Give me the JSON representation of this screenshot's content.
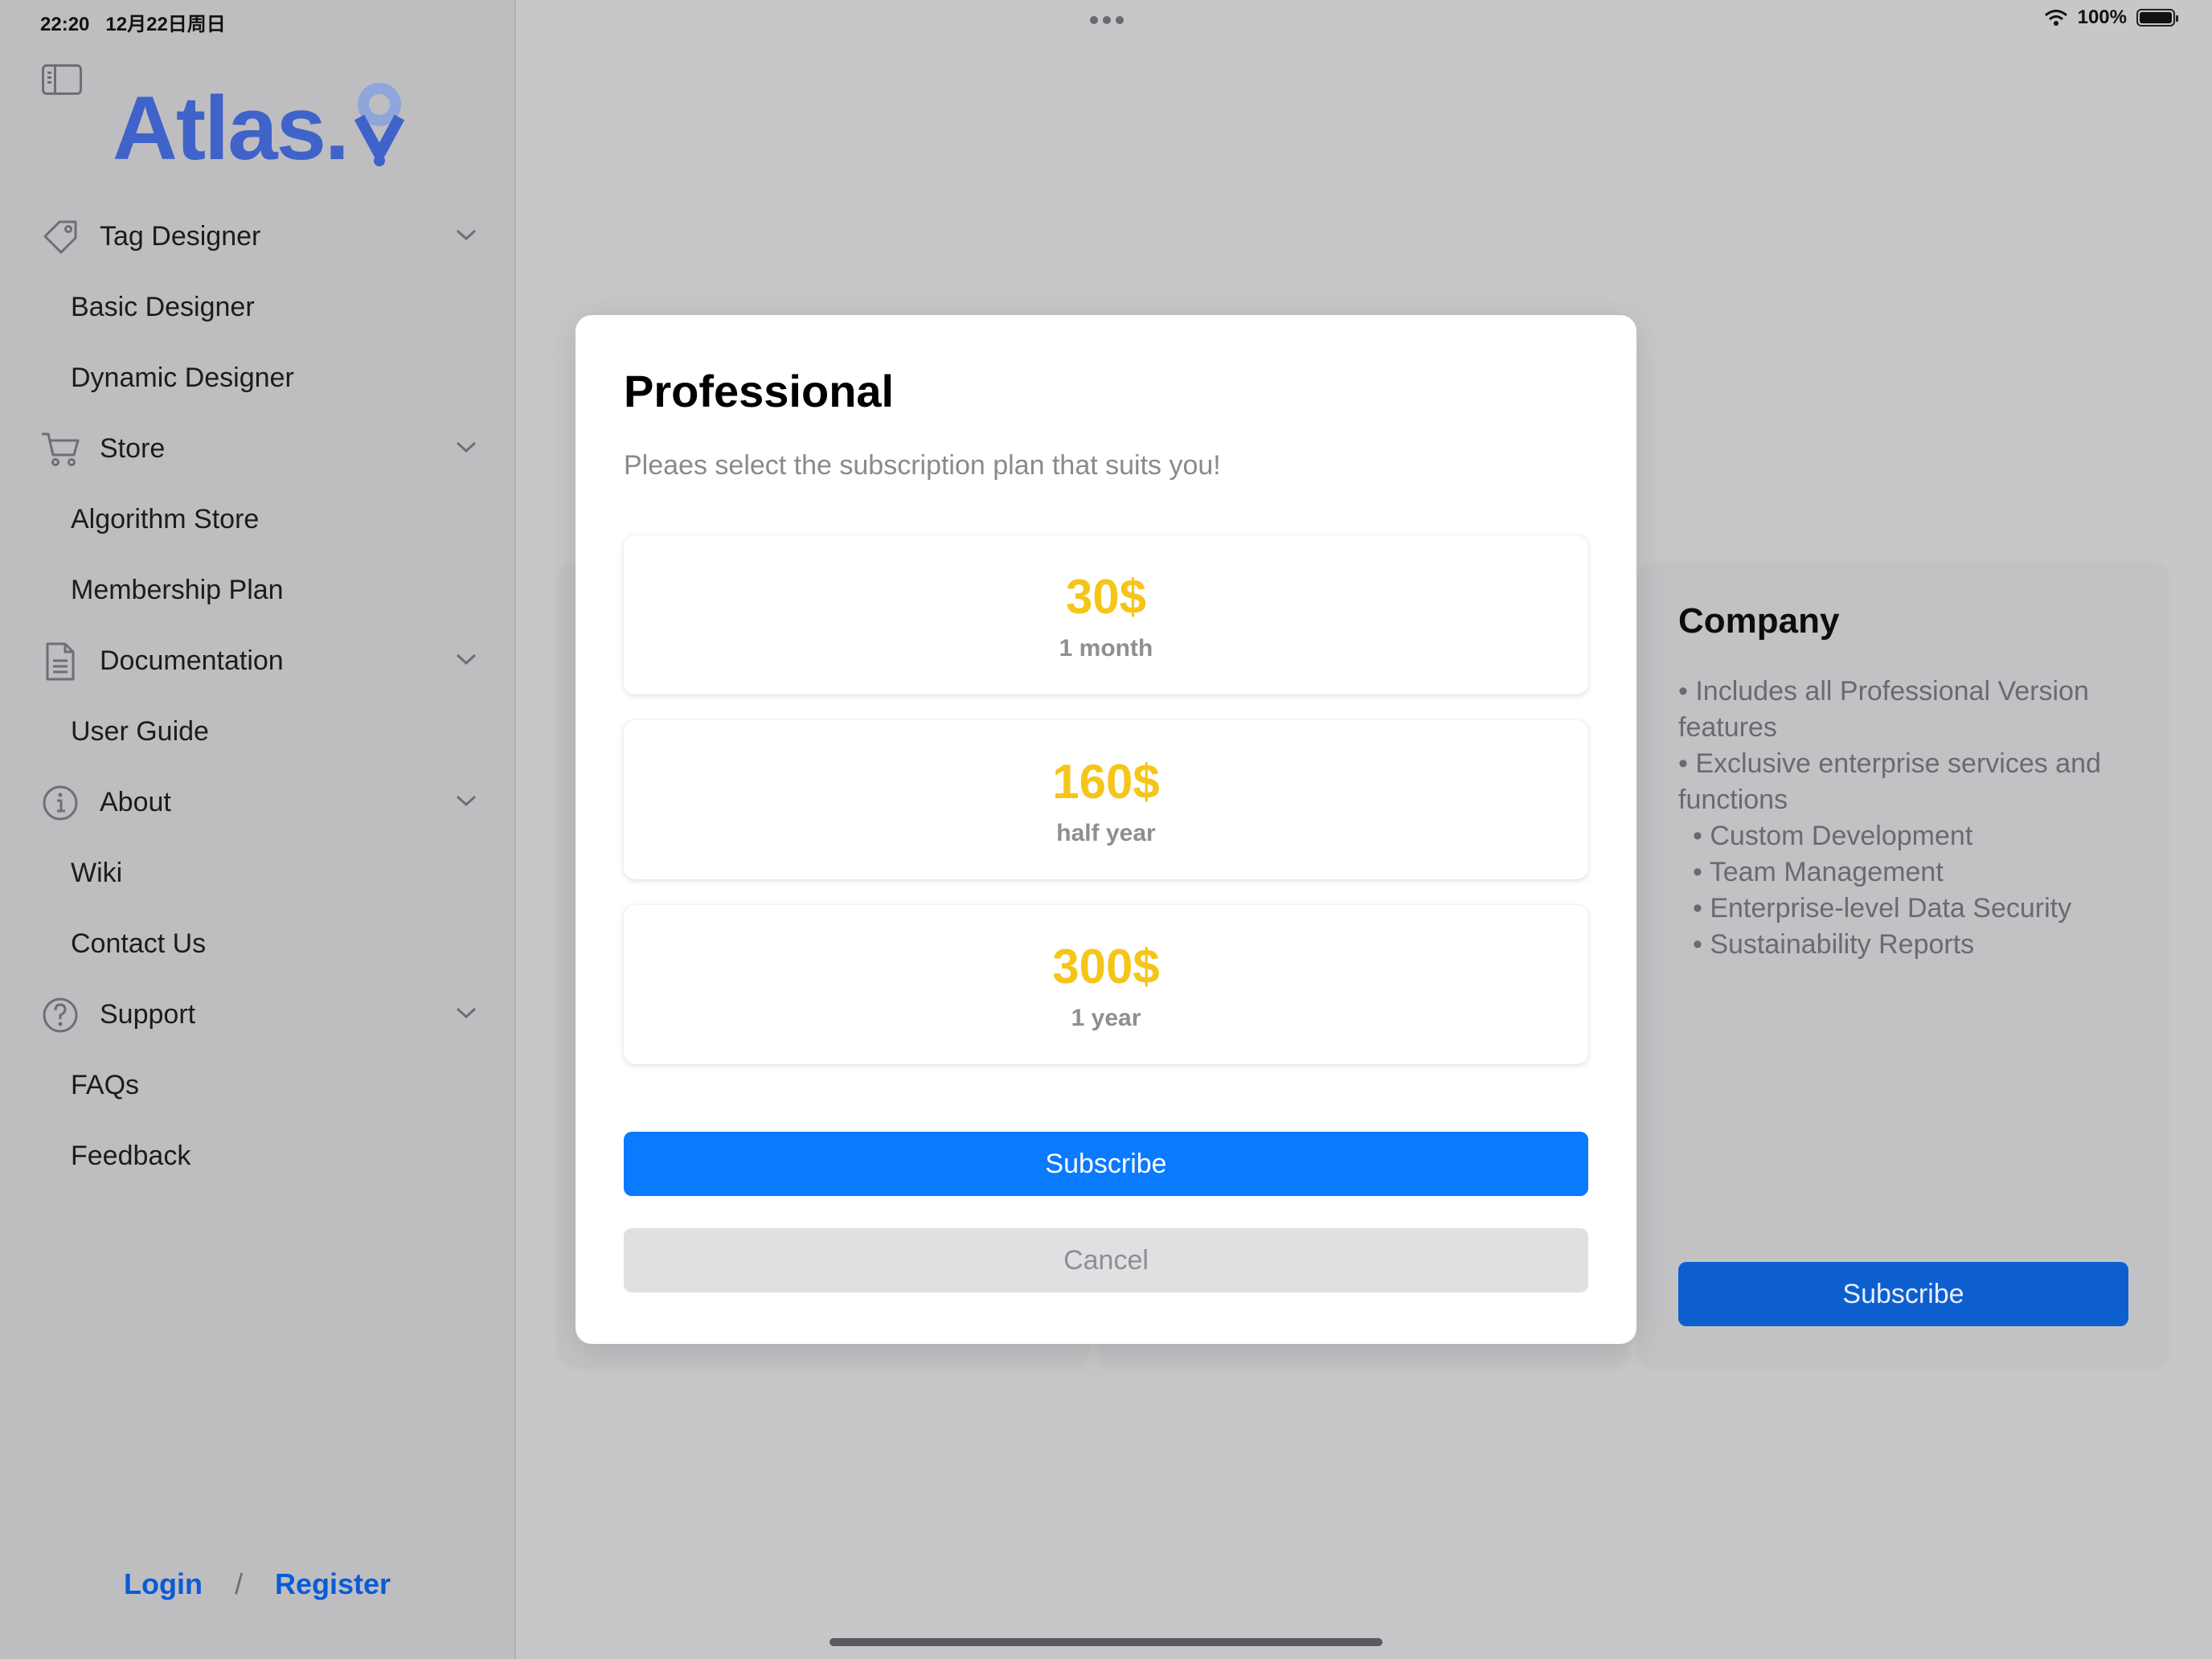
{
  "status_bar": {
    "time": "22:20",
    "date": "12月22日周日",
    "battery": "100%"
  },
  "sidebar": {
    "logo": "Atlas.",
    "sections": [
      {
        "label": "Tag Designer",
        "icon": "tag-icon",
        "items": [
          "Basic Designer",
          "Dynamic Designer"
        ]
      },
      {
        "label": "Store",
        "icon": "cart-icon",
        "items": [
          "Algorithm Store",
          "Membership Plan"
        ]
      },
      {
        "label": "Documentation",
        "icon": "document-icon",
        "items": [
          "User Guide"
        ]
      },
      {
        "label": "About",
        "icon": "info-icon",
        "items": [
          "Wiki",
          "Contact Us"
        ]
      },
      {
        "label": "Support",
        "icon": "question-icon",
        "items": [
          "FAQs",
          "Feedback"
        ]
      }
    ],
    "auth": {
      "login": "Login",
      "separator": "/",
      "register": "Register"
    }
  },
  "company_card": {
    "title": "Company",
    "features": [
      "• Includes all Professional Version features",
      "• Exclusive enterprise services and functions",
      "• Custom Development",
      "• Team Management",
      "• Enterprise-level Data Security",
      "• Sustainability Reports"
    ],
    "subscribe_label": "Subscribe"
  },
  "modal": {
    "title": "Professional",
    "subtitle": "Pleaes select the subscription plan that suits you!",
    "plans": [
      {
        "price": "30$",
        "period": "1 month"
      },
      {
        "price": "160$",
        "period": "half year"
      },
      {
        "price": "300$",
        "period": "1 year"
      }
    ],
    "subscribe_label": "Subscribe",
    "cancel_label": "Cancel"
  },
  "colors": {
    "accent": "#0a7aff",
    "price": "#f5c518",
    "logo": "#3f63c9",
    "link": "#0a5bd6"
  }
}
